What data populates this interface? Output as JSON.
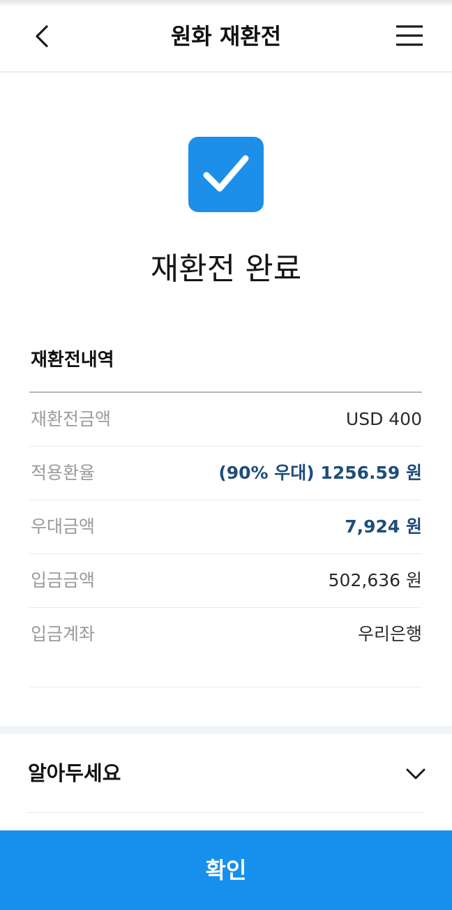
{
  "header": {
    "title": "원화 재환전",
    "back_icon": "chevron-left-icon",
    "menu_icon": "hamburger-menu-icon"
  },
  "status": {
    "icon": "check-square-icon",
    "title": "재환전 완료"
  },
  "details": {
    "section_title": "재환전내역",
    "rows": [
      {
        "label": "재환전금액",
        "value": "USD 400"
      },
      {
        "label": "적용환율",
        "value": "(90% 우대) 1256.59 원"
      },
      {
        "label": "우대금액",
        "value": "7,924 원"
      },
      {
        "label": "입금금액",
        "value": "502,636 원"
      },
      {
        "label": "입금계좌",
        "value": "우리은행"
      }
    ]
  },
  "notice": {
    "title": "알아두세요",
    "icon": "chevron-down-icon"
  },
  "footer": {
    "confirm_label": "확인"
  },
  "colors": {
    "accent": "#1690ec",
    "highlight_text": "#1f4d7a"
  }
}
